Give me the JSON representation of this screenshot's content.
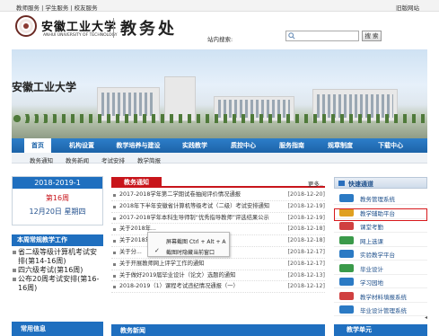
{
  "topbar": {
    "left": "教师服务 | 学生服务 | 校友服务",
    "right": "旧版网站"
  },
  "header": {
    "school_cn": "安徽工业大学",
    "school_en": "ANHUI UNIVERSITY OF TECHNOLOGY",
    "dept": "教务处",
    "search_label": "站内搜索:",
    "search_value": "",
    "search_button": "搜 索"
  },
  "banner": {
    "logo_text": "安徽工业大学"
  },
  "nav": {
    "items": [
      "首页",
      "机构设置",
      "教学培养与建设",
      "实践教学",
      "质控中心",
      "服务指南",
      "规章制度",
      "下载中心"
    ]
  },
  "subnav": {
    "items": [
      "教务通知",
      "教务新闻",
      "考试安排",
      "教学简报"
    ]
  },
  "calendar": {
    "year_month": "2018-2019-1",
    "week": "第16周",
    "date": "12月20日 星期四"
  },
  "weekly": {
    "title": "本周常规教学工作",
    "items": [
      "省二级等级计算机考试安排(第14-16周)",
      "四六级考试(第16周)",
      "公布20周考试安排(第16-16周)"
    ]
  },
  "notice": {
    "title": "教务通知",
    "more": "更多..",
    "items": [
      {
        "text": "2017-2018学年第二学期试卷抽阅评价情况通报",
        "date": "[2018-12-20]",
        "new": true
      },
      {
        "text": "2018年下半年安徽省计算机等级考试（二级）考试安排通知",
        "date": "[2018-12-19]",
        "new": true
      },
      {
        "text": "2017-2018学年本科生导师制“优秀指导教师”评选结果公示",
        "date": "[2018-12-19]",
        "new": true
      },
      {
        "text": "关于2018年...",
        "date": "[2018-12-18]",
        "new": false
      },
      {
        "text": "关于2018年...",
        "date": "[2018-12-18]",
        "new": false
      },
      {
        "text": "关于分...",
        "date": "[2018-12-17]",
        "new": false
      },
      {
        "text": "关于开展教师网上评学工作的通知",
        "date": "[2018-12-17]",
        "new": false
      },
      {
        "text": "关于做好2019届毕业设计（论文）选题的通知",
        "date": "[2018-12-13]",
        "new": false
      },
      {
        "text": "2018-2019（1）课程考试违纪情况通报（一）",
        "date": "[2018-12-12]",
        "new": false
      }
    ],
    "new_badge": "NEW"
  },
  "context_menu": {
    "items": [
      "屏幕截图 Ctrl + Alt + A",
      "截图时隐藏当前窗口"
    ]
  },
  "quick": {
    "title": "快速通道",
    "items": [
      "教务管理系统",
      "教学辅助平台",
      "课堂考勤",
      "网上选课",
      "实验教学平台",
      "毕业设计",
      "学习园地",
      "教学材料填报系统",
      "毕业设计管理系统"
    ]
  },
  "bottom": {
    "left": "常用信息",
    "middle": "教务新闻",
    "right": "教学单元"
  }
}
